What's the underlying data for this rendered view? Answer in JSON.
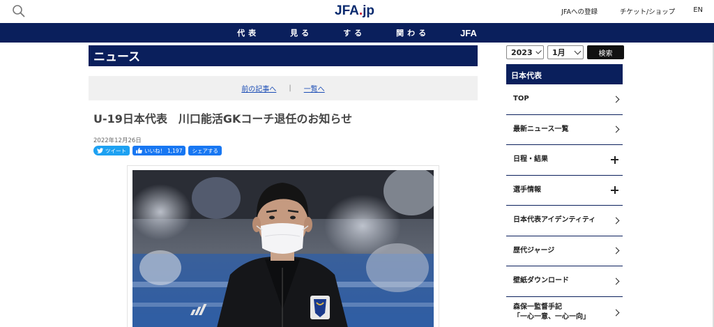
{
  "header": {
    "logo_main": "JFA",
    "logo_dot": ".",
    "logo_suffix": "jp",
    "links": [
      "JFAへの登録",
      "チケット/ショップ",
      "EN"
    ]
  },
  "nav": {
    "items": [
      "代表",
      "見る",
      "する",
      "関わる",
      "JFA"
    ]
  },
  "section": {
    "title": "ニュース"
  },
  "pager": {
    "prev": "前の記事へ",
    "separator": "|",
    "list": "一覧へ"
  },
  "article": {
    "title": "U-19日本代表　川口能活GKコーチ退任のお知らせ",
    "date": "2022年12月26日",
    "tweet": "ツイート",
    "like": "いいね！",
    "like_count": "1,197",
    "share": "シェアする"
  },
  "filters": {
    "year": "2023",
    "month": "1月",
    "search": "検索"
  },
  "sidebar": {
    "head": "日本代表",
    "items": [
      {
        "label": "TOP",
        "icon": "arrow"
      },
      {
        "label": "最新ニュース一覧",
        "icon": "arrow"
      },
      {
        "label": "日程・結果",
        "icon": "plus"
      },
      {
        "label": "選手情報",
        "icon": "plus"
      },
      {
        "label": "日本代表アイデンティティ",
        "icon": "arrow"
      },
      {
        "label": "歴代ジャージ",
        "icon": "arrow"
      },
      {
        "label": "壁紙ダウンロード",
        "icon": "arrow"
      },
      {
        "label": "森保一監督手記",
        "label2": "「一心一意、一心一向」",
        "icon": "arrow"
      }
    ]
  },
  "colors": {
    "navy": "#0a1f5c",
    "accent_red": "#d0102a",
    "link_blue": "#1a4cb5"
  }
}
